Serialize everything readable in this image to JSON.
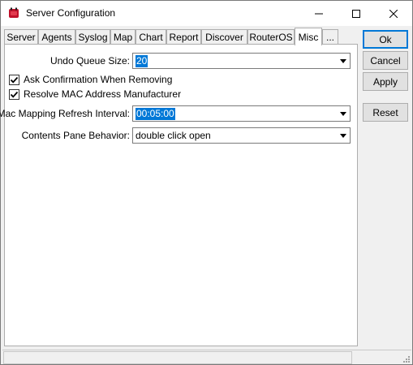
{
  "window": {
    "title": "Server Configuration"
  },
  "titlebar": {
    "min_icon": "minimize-icon",
    "max_icon": "maximize-icon",
    "close_icon": "close-icon"
  },
  "tabs": [
    {
      "label": "Server",
      "active": false
    },
    {
      "label": "Agents",
      "active": false
    },
    {
      "label": "Syslog",
      "active": false
    },
    {
      "label": "Map",
      "active": false
    },
    {
      "label": "Chart",
      "active": false
    },
    {
      "label": "Report",
      "active": false
    },
    {
      "label": "Discover",
      "active": false
    },
    {
      "label": "RouterOS",
      "active": false
    },
    {
      "label": "Misc",
      "active": true
    },
    {
      "label": "...",
      "active": false
    }
  ],
  "misc": {
    "undo_queue_label": "Undo Queue Size:",
    "undo_queue_value": "20",
    "ask_confirmation_label": "Ask Confirmation When Removing",
    "ask_confirmation_checked": true,
    "resolve_mac_label": "Resolve MAC Address Manufacturer",
    "resolve_mac_checked": true,
    "mac_refresh_label": "Mac Mapping Refresh Interval:",
    "mac_refresh_value": "00:05:00",
    "contents_pane_label": "Contents Pane Behavior:",
    "contents_pane_value": "double click open"
  },
  "buttons": {
    "ok": "Ok",
    "cancel": "Cancel",
    "apply": "Apply",
    "reset": "Reset"
  },
  "colors": {
    "accent": "#0078d7",
    "panel": "#ffffff",
    "chrome": "#f0f0f0"
  }
}
